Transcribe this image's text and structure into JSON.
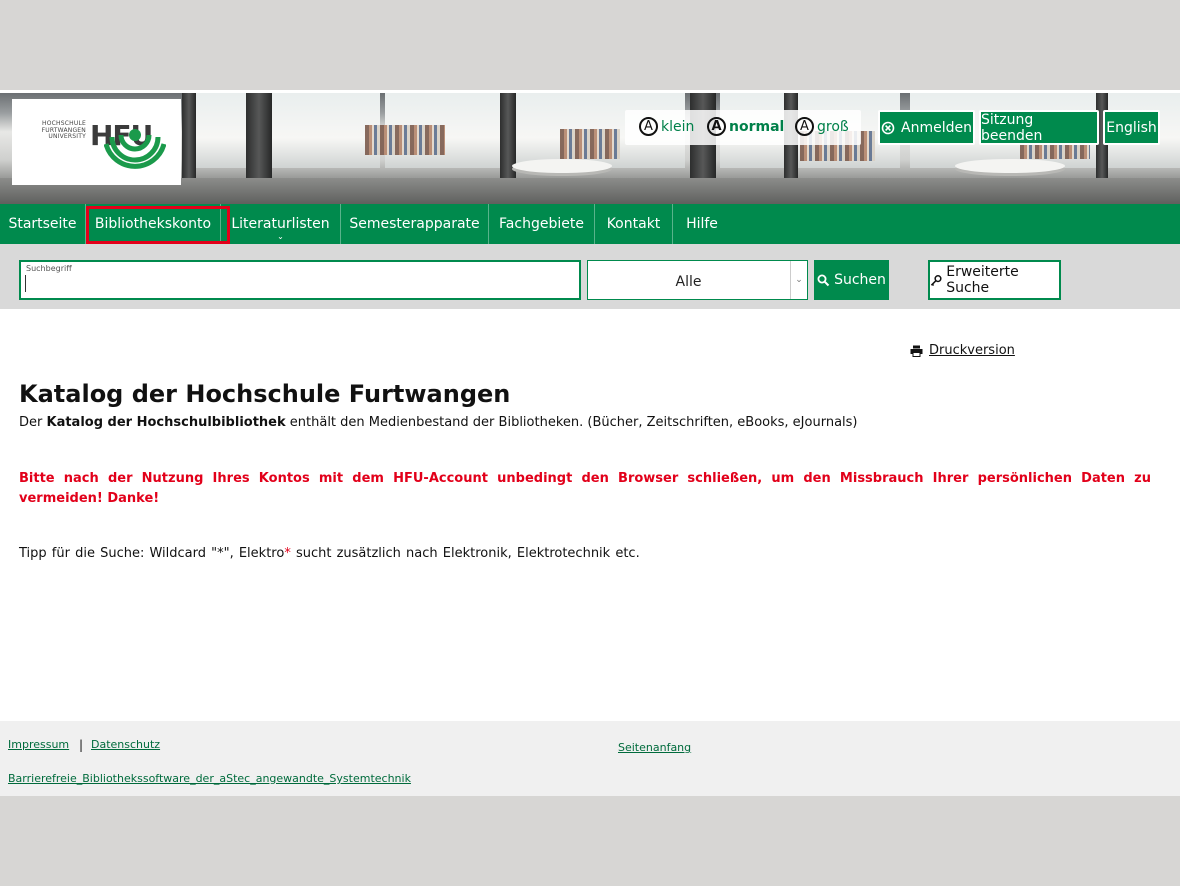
{
  "header": {
    "logo": {
      "small_text": "HOCHSCHULE FURTWANGEN UNIVERSITY",
      "mark_text": "HFU"
    },
    "font_size": {
      "small": "klein",
      "normal": "normal",
      "large": "groß",
      "glyph": "A"
    },
    "buttons": {
      "login": "Anmelden",
      "end_session": "Sitzung beenden",
      "language": "English"
    }
  },
  "nav": {
    "items": [
      {
        "label": "Startseite"
      },
      {
        "label": "Bibliothekskonto"
      },
      {
        "label": "Literaturlisten"
      },
      {
        "label": "Semesterapparate"
      },
      {
        "label": "Fachgebiete"
      },
      {
        "label": "Kontakt"
      },
      {
        "label": "Hilfe"
      }
    ],
    "highlight_color": "#e2001a"
  },
  "search": {
    "label": "Suchbegriff",
    "value": "",
    "scope": "Alle",
    "submit": "Suchen",
    "advanced": "Erweiterte Suche"
  },
  "content": {
    "print": "Druckversion",
    "title": "Katalog der Hochschule Furtwangen",
    "intro_prefix": "Der",
    "intro_bold": "Katalog der Hochschulbibliothek",
    "intro_rest": "enthält den Medienbestand der Bibliotheken. (Bücher, Zeitschriften, eBooks, eJournals)",
    "warning": "Bitte nach der Nutzung Ihres Kontos mit dem HFU-Account unbedingt den Browser schließen, um den Missbrauch Ihrer persönlichen Daten zu vermeiden! Danke!",
    "tip_prefix": "Tipp für die Suche: Wildcard \"*\", Elektro",
    "tip_star": "*",
    "tip_rest": "sucht zusätzlich nach Elektronik, Elektrotechnik etc."
  },
  "footer": {
    "impressum": "Impressum",
    "separator": "|",
    "datenschutz": "Datenschutz",
    "top": "Seitenanfang",
    "software": "Barrierefreie_Bibliothekssoftware_der_aStec_angewandte_Systemtechnik"
  },
  "colors": {
    "brand_green": "#008a4d",
    "warning_red": "#e2001a"
  }
}
